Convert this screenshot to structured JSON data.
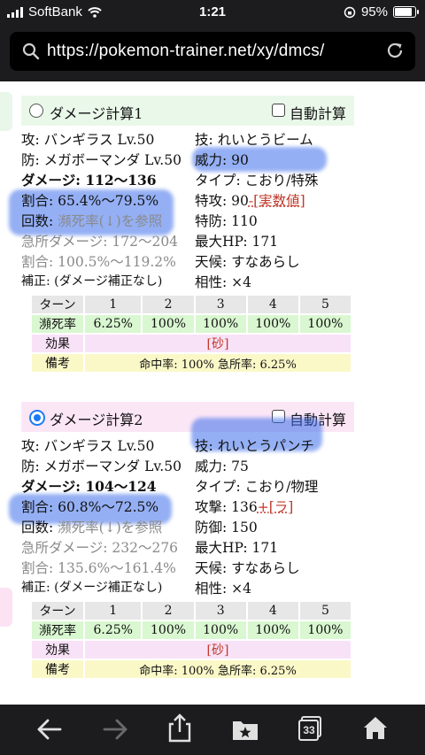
{
  "status": {
    "carrier": "SoftBank",
    "time": "1:21",
    "battery": "95%",
    "battery_level": 0.95
  },
  "url": {
    "address": "https://pokemon-trainer.net/xy/dmcs/"
  },
  "calc1": {
    "title": "ダメージ計算1",
    "auto_label": "自動計算",
    "left": {
      "attacker": "攻: バンギラス Lv.50",
      "defender": "防: メガボーマンダ Lv.50",
      "damage": "ダメージ: 112〜136",
      "ratio": "割合: 65.4%〜79.5%",
      "count_prefix": "回数: ",
      "count_link": "瀕死率(↓)を参照",
      "crit_damage": "急所ダメージ: 172〜204",
      "crit_ratio": "割合: 100.5%〜119.2%",
      "correction": "補正: (ダメージ補正なし)"
    },
    "right": {
      "move": "技: れいとうビーム",
      "power": "威力: 90",
      "type": "タイプ: こおり/特殊",
      "stat_prefix": "特攻: 90",
      "stat_link": "-[実数値]",
      "defstat": "特防: 110",
      "hp": "最大HP: 171",
      "weather": "天候: すなあらし",
      "effectiveness": "相性: ×4"
    },
    "table": {
      "turn_label": "ターン",
      "turns": [
        "1",
        "2",
        "3",
        "4",
        "5"
      ],
      "rate_label": "瀕死率",
      "rates": [
        "6.25%",
        "100%",
        "100%",
        "100%",
        "100%"
      ],
      "effect_label": "効果",
      "effect_value": "[砂]",
      "note_label": "備考",
      "note_value": "命中率: 100% 急所率: 6.25%"
    }
  },
  "calc2": {
    "title": "ダメージ計算2",
    "auto_label": "自動計算",
    "left": {
      "attacker": "攻: バンギラス Lv.50",
      "defender": "防: メガボーマンダ Lv.50",
      "damage": "ダメージ: 104〜124",
      "ratio": "割合: 60.8%〜72.5%",
      "count_prefix": "回数: ",
      "count_link": "瀕死率(↓)を参照",
      "crit_damage": "急所ダメージ: 232〜276",
      "crit_ratio": "割合: 135.6%〜161.4%",
      "correction": "補正: (ダメージ補正なし)"
    },
    "right": {
      "move": "技: れいとうパンチ",
      "power": "威力: 75",
      "type": "タイプ: こおり/物理",
      "stat_prefix": "攻撃: 136",
      "stat_link": "+[ラ]",
      "defstat": "防御: 150",
      "hp": "最大HP: 171",
      "weather": "天候: すなあらし",
      "effectiveness": "相性: ×4"
    },
    "table": {
      "turn_label": "ターン",
      "turns": [
        "1",
        "2",
        "3",
        "4",
        "5"
      ],
      "rate_label": "瀕死率",
      "rates": [
        "6.25%",
        "100%",
        "100%",
        "100%",
        "100%"
      ],
      "effect_label": "効果",
      "effect_value": "[砂]",
      "note_label": "備考",
      "note_value": "命中率: 100% 急所率: 6.25%"
    }
  },
  "toolbar": {
    "tabs_count": "33"
  },
  "colors": {
    "accent": "#1a7cf5",
    "highlight": "#3c6eeb",
    "rate_bg": "#d9f7d0",
    "effect_bg": "#f8e2f7",
    "note_bg": "#fbf8c8",
    "calc1_bg": "#eaf8ea",
    "calc2_bg": "#fbe6f6"
  }
}
